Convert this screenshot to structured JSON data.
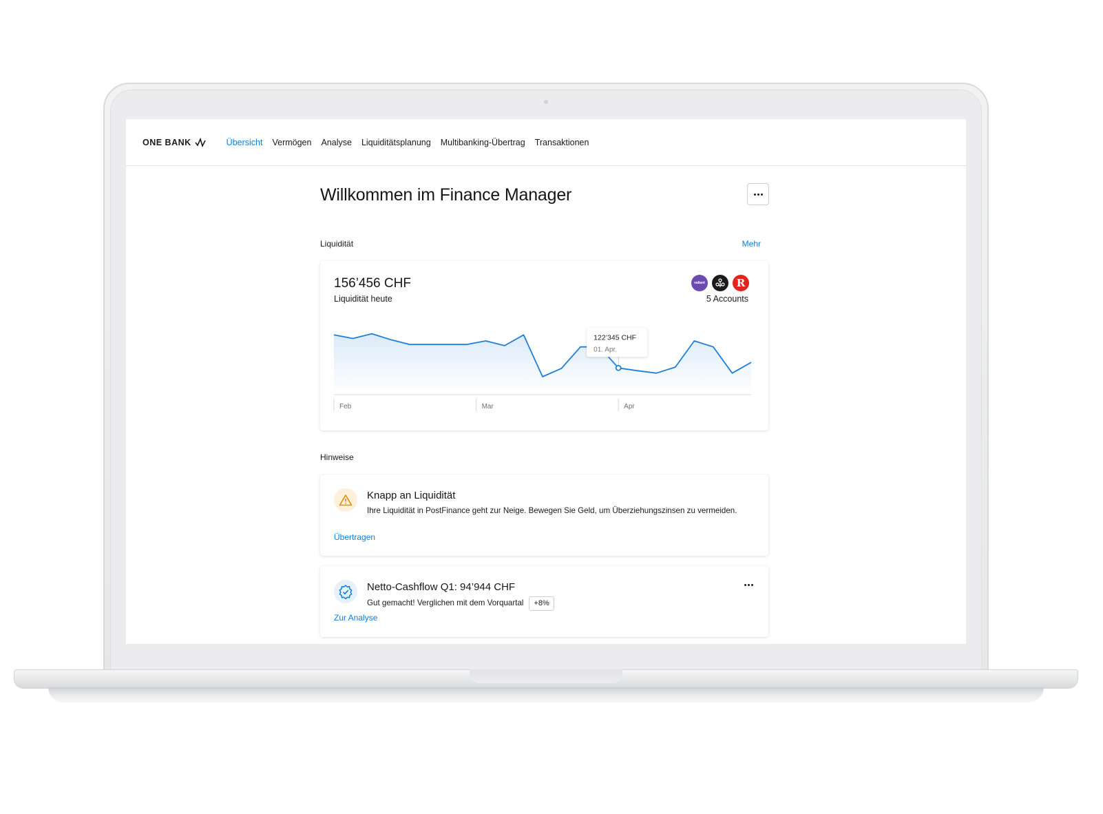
{
  "nav": {
    "brand": "ONE BANK",
    "items": [
      {
        "label": "Übersicht",
        "active": true
      },
      {
        "label": "Vermögen",
        "active": false
      },
      {
        "label": "Analyse",
        "active": false
      },
      {
        "label": "Liquiditätsplanung",
        "active": false
      },
      {
        "label": "Multibanking-Übertrag",
        "active": false
      },
      {
        "label": "Transaktionen",
        "active": false
      }
    ]
  },
  "page": {
    "title": "Willkommen im Finance Manager"
  },
  "liquidity": {
    "section_label": "Liquidität",
    "more_link": "Mehr",
    "amount": "156’456 CHF",
    "subtitle": "Liquidität heute",
    "banks": [
      {
        "name": "valiant",
        "icon": "valiant-logo-icon",
        "color": "#6c4bb0"
      },
      {
        "name": "",
        "icon": "ubs-keys-logo-icon",
        "color": "#1b1b1b"
      },
      {
        "name": "R",
        "icon": "raiffeisen-logo-icon",
        "color": "#e3231c"
      }
    ],
    "accounts": "5 Accounts"
  },
  "chart_data": {
    "type": "area",
    "title": "",
    "xlabel": "",
    "ylabel": "",
    "x_ticks": [
      "Feb",
      "Mar",
      "Apr"
    ],
    "tooltip": {
      "value": "122’345 CHF",
      "date": "01. Apr.",
      "index": 15
    },
    "series": [
      {
        "values": [
          150000,
          147000,
          151000,
          146000,
          142000,
          142000,
          142000,
          142000,
          145000,
          141000,
          150000,
          115000,
          122000,
          140000,
          140000,
          122345,
          120000,
          118000,
          123000,
          145000,
          140000,
          118000,
          127000
        ]
      }
    ],
    "grid": false,
    "accent_color": "#1e7fd8"
  },
  "hints": {
    "section_label": "Hinweise",
    "items": [
      {
        "icon": "warning-triangle-icon",
        "title": "Knapp an Liquidität",
        "text": "Ihre Liquidität in PostFinance geht zur Neige. Bewegen Sie Geld, um Überziehungszinsen zu vermeiden.",
        "link": "Übertragen"
      },
      {
        "icon": "verified-badge-icon",
        "title": "Netto-Cashflow Q1: 94’944 CHF",
        "text": "Gut gemacht! Verglichen mit dem Vorquartal",
        "badge": "+8%",
        "link": "Zur Analyse"
      }
    ]
  }
}
